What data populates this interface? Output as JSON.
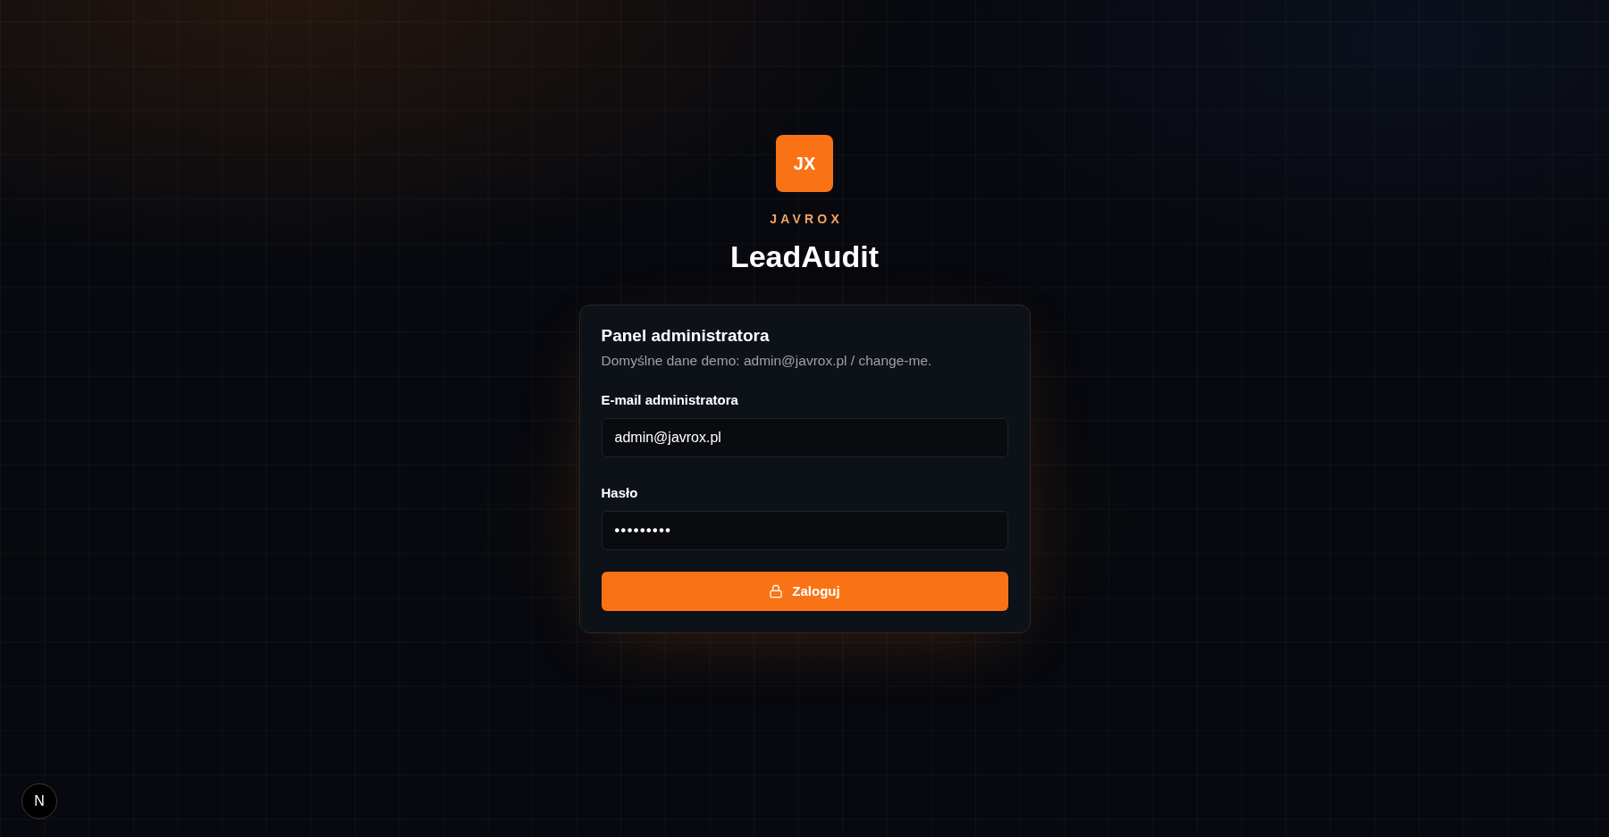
{
  "brand": {
    "logo_mark": "JX",
    "name": "JAVROX",
    "product": "LeadAudit"
  },
  "login_card": {
    "title": "Panel administratora",
    "subtitle": "Domyślne dane demo: admin@javrox.pl / change-me.",
    "fields": [
      {
        "label": "E-mail administratora",
        "kind": "email",
        "value": "admin@javrox.pl"
      },
      {
        "label": "Hasło",
        "kind": "password",
        "value": "•••••••••"
      }
    ],
    "submit_button": "Zaloguj"
  },
  "dev_indicator": "N"
}
